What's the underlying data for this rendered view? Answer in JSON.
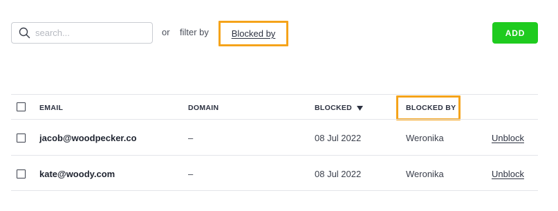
{
  "toolbar": {
    "search_placeholder": "search...",
    "or_label": "or",
    "filter_label": "filter by",
    "filter_value": "Blocked by",
    "add_label": "ADD"
  },
  "table": {
    "headers": {
      "email": "EMAIL",
      "domain": "DOMAIN",
      "blocked": "BLOCKED",
      "blocked_by": "BLOCKED BY"
    },
    "sort": {
      "column": "blocked",
      "direction": "descending"
    },
    "rows": [
      {
        "email": "jacob@woodpecker.co",
        "domain": "–",
        "blocked": "08 Jul 2022",
        "blocked_by": "Weronika",
        "action": "Unblock"
      },
      {
        "email": "kate@woody.com",
        "domain": "–",
        "blocked": "08 Jul 2022",
        "blocked_by": "Weronika",
        "action": "Unblock"
      }
    ]
  },
  "colors": {
    "accent_highlight": "#f5a31a",
    "add_button": "#1fcb1f"
  },
  "icons": {
    "search": "search-icon",
    "sort": "sort-down-icon"
  }
}
